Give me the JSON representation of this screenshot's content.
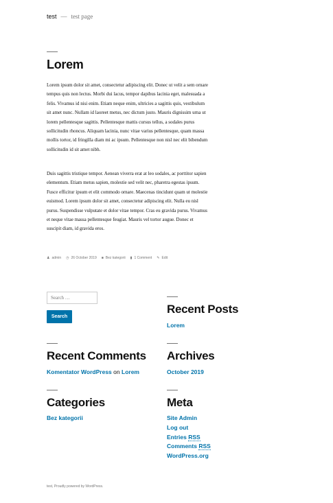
{
  "header": {
    "site_title": "test",
    "separator": "—",
    "description": "test page"
  },
  "post": {
    "title": "Lorem",
    "paragraphs": [
      "Lorem ipsum dolor sit amet, consectetur adipiscing elit. Donec ut velit a sem ornare tempus quis non lectus. Morbi dui lacus, tempor dapibus lacinia eget, malesuada a felis. Vivamus id nisi enim. Etiam neque enim, ultricies a sagittis quis, vestibulum sit amet nunc. Nullam id laoreet metus, nec dictum justo. Mauris dignissim urna ut lorem pellentesque sagittis. Pellentesque mattis cursus tellus, a sodales purus sollicitudin rhoncus. Aliquam lacinia, nunc vitae varius pellentesque, quam massa mollis tortor, id fringilla diam mi ac ipsum. Pellentesque non nisl nec elit bibendum sollicitudin id sit amet nibh.",
      "Duis sagittis tristique tempor. Aenean viverra erat at leo sodales, ac porttitor sapien elementum. Etiam metus sapien, molestie sed velit nec, pharetra egestas ipsum. Fusce efficitur ipsum et elit commodo ornare. Maecenas tincidunt quam ut molestie euismod. Lorem ipsum dolor sit amet, consectetur adipiscing elit. Nulla eu nisl purus. Suspendisse vulputate et dolor vitae tempor. Cras eu gravida purus. Vivamus et neque vitae massa pellentesque feugiat. Mauris vel tortor augue. Donec et suscipit diam, id gravida eros."
    ],
    "meta": {
      "author": "admin",
      "date": "26 October 2019",
      "category": "Bez kategorii",
      "comments": "1 Comment",
      "edit": "Edit"
    }
  },
  "widgets": {
    "search": {
      "placeholder": "Search …",
      "button": "Search"
    },
    "recent_posts": {
      "title": "Recent Posts",
      "items": [
        "Lorem"
      ]
    },
    "recent_comments": {
      "title": "Recent Comments",
      "author": "Komentator WordPress",
      "on": "on",
      "post": "Lorem"
    },
    "archives": {
      "title": "Archives",
      "items": [
        "October 2019"
      ]
    },
    "categories": {
      "title": "Categories",
      "items": [
        "Bez kategorii"
      ]
    },
    "meta": {
      "title": "Meta",
      "site_admin": "Site Admin",
      "log_out": "Log out",
      "entries": "Entries",
      "comments": "Comments",
      "rss": "RSS",
      "wordpress_org": "WordPress.org"
    }
  },
  "footer": {
    "text": "test, Proudly powered by WordPress."
  },
  "colors": {
    "link": "#0073aa",
    "text": "#111111",
    "muted": "#767676"
  }
}
